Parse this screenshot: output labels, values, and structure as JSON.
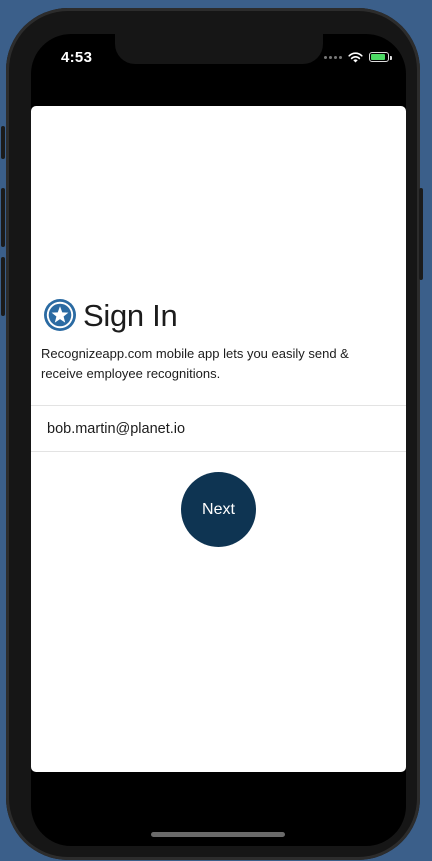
{
  "status_bar": {
    "time": "4:53",
    "battery_level": 0.85,
    "battery_color": "#4cd964"
  },
  "icons": {
    "brand": "star-badge-icon",
    "wifi": "wifi-icon",
    "battery": "battery-charging-icon"
  },
  "signin": {
    "title": "Sign In",
    "description": "Recognizeapp.com mobile app lets you easily send & receive employee recognitions.",
    "email_value": "bob.martin@planet.io",
    "next_label": "Next"
  },
  "colors": {
    "button": "#0e3452",
    "brand_icon": "#2a6aa2",
    "background": "#3b5f8a"
  }
}
